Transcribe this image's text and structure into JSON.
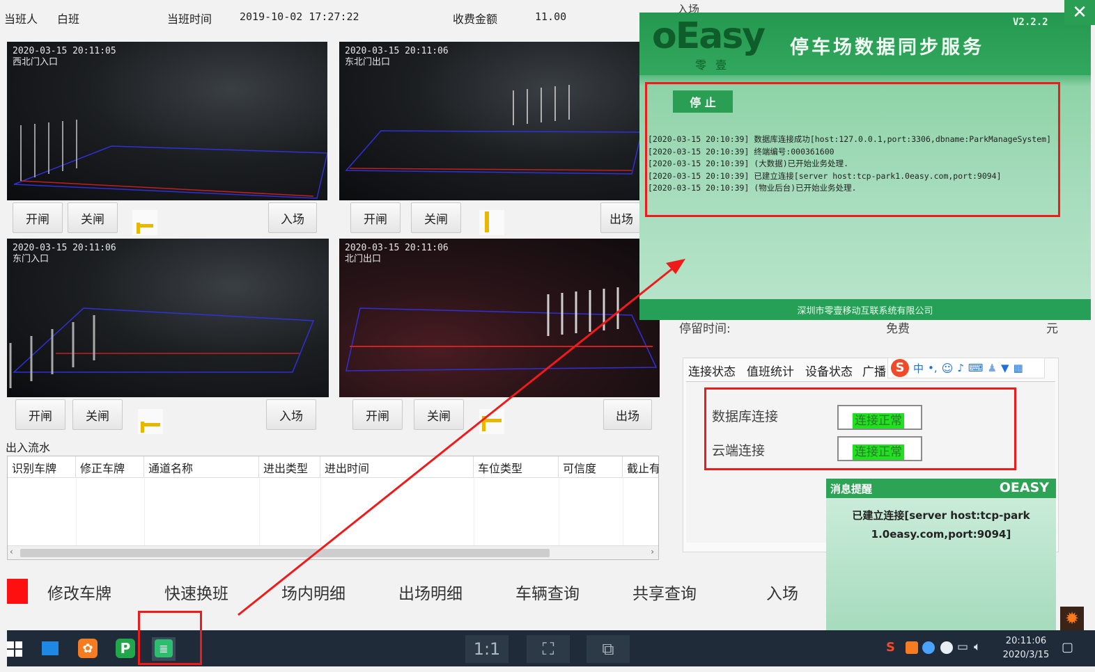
{
  "header": {
    "shift_person_label": "当班人",
    "shift_person_value": "白班",
    "shift_time_label": "当班时间",
    "shift_time_value": "2019-10-02 17:27:22",
    "fee_label": "收费金额",
    "fee_value": "11.00"
  },
  "cameras": [
    {
      "timestamp": "2020-03-15 20:11:05",
      "gate": "西北门入口"
    },
    {
      "timestamp": "2020-03-15 20:11:06",
      "gate": "东北门出口"
    },
    {
      "timestamp": "2020-03-15 20:11:06",
      "gate": "东门入口"
    },
    {
      "timestamp": "2020-03-15 20:11:06",
      "gate": "北门出口"
    }
  ],
  "lane_controls": {
    "open": "开闸",
    "close": "关闸",
    "entry": "入场",
    "exit": "出场"
  },
  "flow": {
    "title": "出入流水",
    "columns": [
      "识别车牌",
      "修正车牌",
      "通道名称",
      "进出类型",
      "进出时间",
      "车位类型",
      "可信度",
      "截止有"
    ]
  },
  "function_bar": [
    "修改车牌",
    "快速换班",
    "场内明细",
    "出场明细",
    "车辆查询",
    "共享查询",
    "入场"
  ],
  "sync_window": {
    "logo": "oEasy",
    "logo_sub": "零 壹",
    "title": "停车场数据同步服务",
    "version": "V2.2.2",
    "stop_button": "停 止",
    "log_lines": [
      "[2020-03-15 20:10:39] 数据库连接成功[host:127.0.0.1,port:3306,dbname:ParkManageSystem]",
      "[2020-03-15 20:10:39] 终端编号:000361600",
      "[2020-03-15 20:10:39] (大数据)已开始业务处理.",
      "[2020-03-15 20:10:39] 已建立连接[server host:tcp-park1.0easy.com,port:9094]",
      "[2020-03-15 20:10:39] (物业后台)已开始业务处理."
    ],
    "footer": "深圳市零壹移动互联系统有限公司"
  },
  "right_panel": {
    "top_label": "入场",
    "stay_label": "停留时间:",
    "stay_value": "免费",
    "unit": "元",
    "tabs": [
      "连接状态",
      "值班统计",
      "设备状态",
      "广播"
    ],
    "db_label": "数据库连接",
    "db_status": "连接正常",
    "cloud_label": "云端连接",
    "cloud_status": "连接正常"
  },
  "notification": {
    "title": "消息提醒",
    "brand": "OEASY",
    "message": "已建立连接[server host:tcp-park1.0easy.com,port:9094]"
  },
  "taskbar": {
    "btn_ratio": "1:1",
    "time": "20:11:06",
    "date": "2020/3/15"
  },
  "colors": {
    "accent_green": "#2fa35a",
    "status_green": "#20e020",
    "highlight_red": "#ef1b1b",
    "taskbar": "#1f2b38"
  }
}
